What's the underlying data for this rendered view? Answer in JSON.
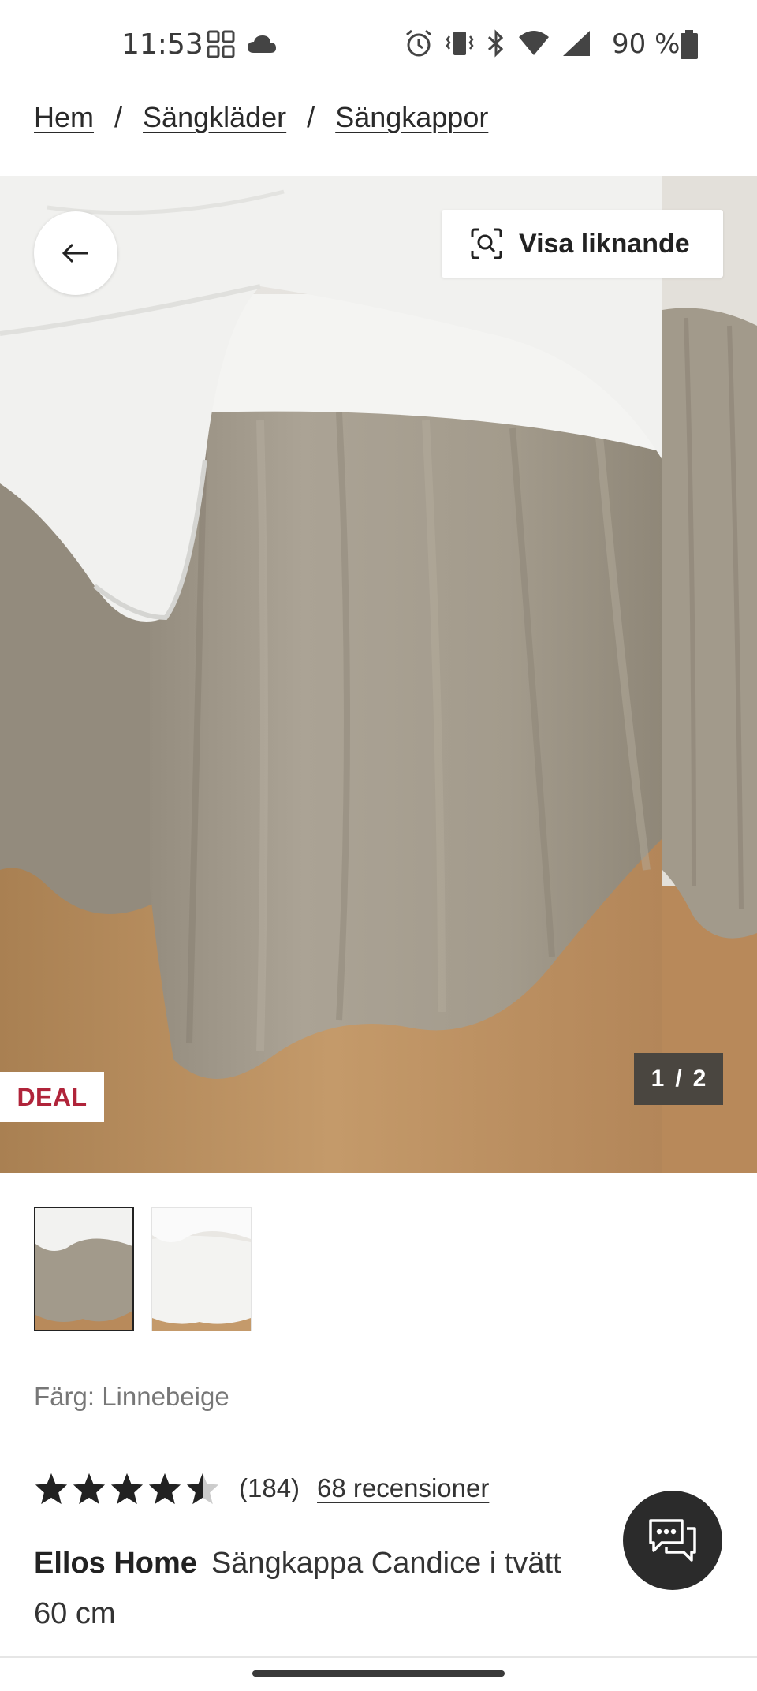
{
  "status_bar": {
    "time": "11:53",
    "battery": "90 %",
    "icons": [
      "grid-icon",
      "cloud-icon",
      "alarm-icon",
      "vibrate-icon",
      "bluetooth-icon",
      "wifi-icon",
      "signal-icon",
      "battery-icon"
    ]
  },
  "breadcrumb": {
    "items": [
      "Hem",
      "Sängkläder",
      "Sängkappor"
    ],
    "separator": "/"
  },
  "gallery": {
    "similar_label": "Visa liknande",
    "deal_label": "DEAL",
    "counter": {
      "current": "1",
      "sep": "/",
      "total": "2"
    },
    "back_icon": "arrow-left-icon",
    "similar_icon": "visual-search-icon"
  },
  "product": {
    "color_label": "Färg: Linnebeige",
    "rating": 4.5,
    "rating_count": "(184)",
    "reviews_link": "68 recensioner",
    "brand": "Ellos Home",
    "name": "Sängkappa Candice i tvätt",
    "name_line2": "60 cm"
  },
  "colors": {
    "deal": "#b0243a",
    "linen": "#a49c8d",
    "duvet": "#f0f0ee",
    "floor": "#b58a5d",
    "chat_bg": "#2b2b2b"
  },
  "chat": {
    "icon": "chat-bubbles-icon"
  }
}
